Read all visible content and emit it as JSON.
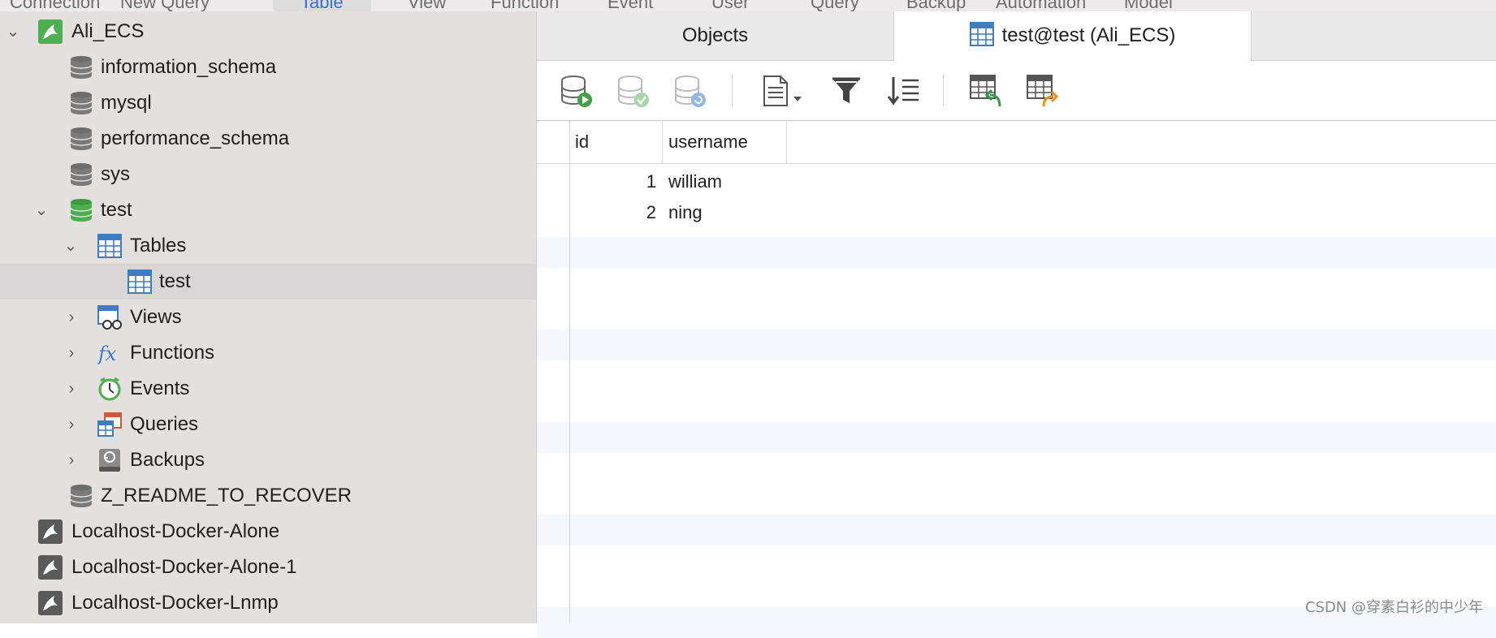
{
  "top_toolbar": {
    "items": [
      "Connection",
      "New Query",
      "Table",
      "View",
      "Function",
      "Event",
      "User",
      "Query",
      "Backup",
      "Automation",
      "Model"
    ],
    "active": "Table"
  },
  "sidebar": {
    "connection": "Ali_ECS",
    "databases": [
      "information_schema",
      "mysql",
      "performance_schema",
      "sys"
    ],
    "open_database": "test",
    "tables_group": "Tables",
    "table_item": "test",
    "groups": [
      "Views",
      "Functions",
      "Events",
      "Queries",
      "Backups"
    ],
    "last_database": "Z_README_TO_RECOVER",
    "other_connections": [
      "Localhost-Docker-Alone",
      "Localhost-Docker-Alone-1",
      "Localhost-Docker-Lnmp"
    ]
  },
  "tabs": {
    "objects": "Objects",
    "active": "test@test (Ali_ECS)"
  },
  "toolbar_icons": [
    "begin-transaction-icon",
    "commit-icon",
    "rollback-icon",
    "text-view-icon",
    "filter-icon",
    "sort-icon",
    "import-icon",
    "export-icon"
  ],
  "grid": {
    "columns": [
      "id",
      "username"
    ],
    "rows": [
      [
        "1",
        "william"
      ],
      [
        "2",
        "ning"
      ]
    ]
  },
  "watermark": "CSDN @穿素白衫的中少年",
  "colors": {
    "sidebar_bg": "#e4e0e0",
    "mysql_green": "#4caf50",
    "db_gray": "#6d6d6d",
    "table_blue": "#3e7cc3"
  }
}
